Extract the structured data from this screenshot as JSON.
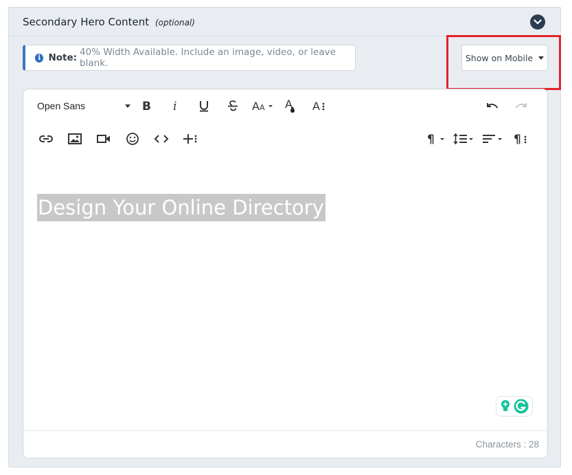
{
  "section": {
    "title": "Secondary Hero Content",
    "optional_label": "(optional)"
  },
  "note": {
    "label": "Note:",
    "text": "40% Width Available. Include an image, video, or leave blank."
  },
  "visibility_select": {
    "value": "Show on Mobile"
  },
  "editor": {
    "font_family": "Open Sans",
    "toolbar_row1": [
      "bold",
      "italic",
      "underline",
      "strikethrough",
      "font-size",
      "text-color",
      "more-text"
    ],
    "toolbar_row2": [
      "insert-link",
      "insert-image",
      "insert-video",
      "emoticons",
      "code-view",
      "more-insert"
    ],
    "toolbar_right1": [
      "undo",
      "redo"
    ],
    "toolbar_right2": [
      "paragraph-format",
      "line-height",
      "align",
      "more-paragraph"
    ],
    "content": "Design Your Online Directory",
    "char_count_text": "Characters : 28"
  },
  "colors": {
    "accent_blue": "#3a78c9",
    "highlight_red": "#e2232a",
    "grammarly_green": "#15c39a",
    "dark_navy": "#2d3e50"
  }
}
